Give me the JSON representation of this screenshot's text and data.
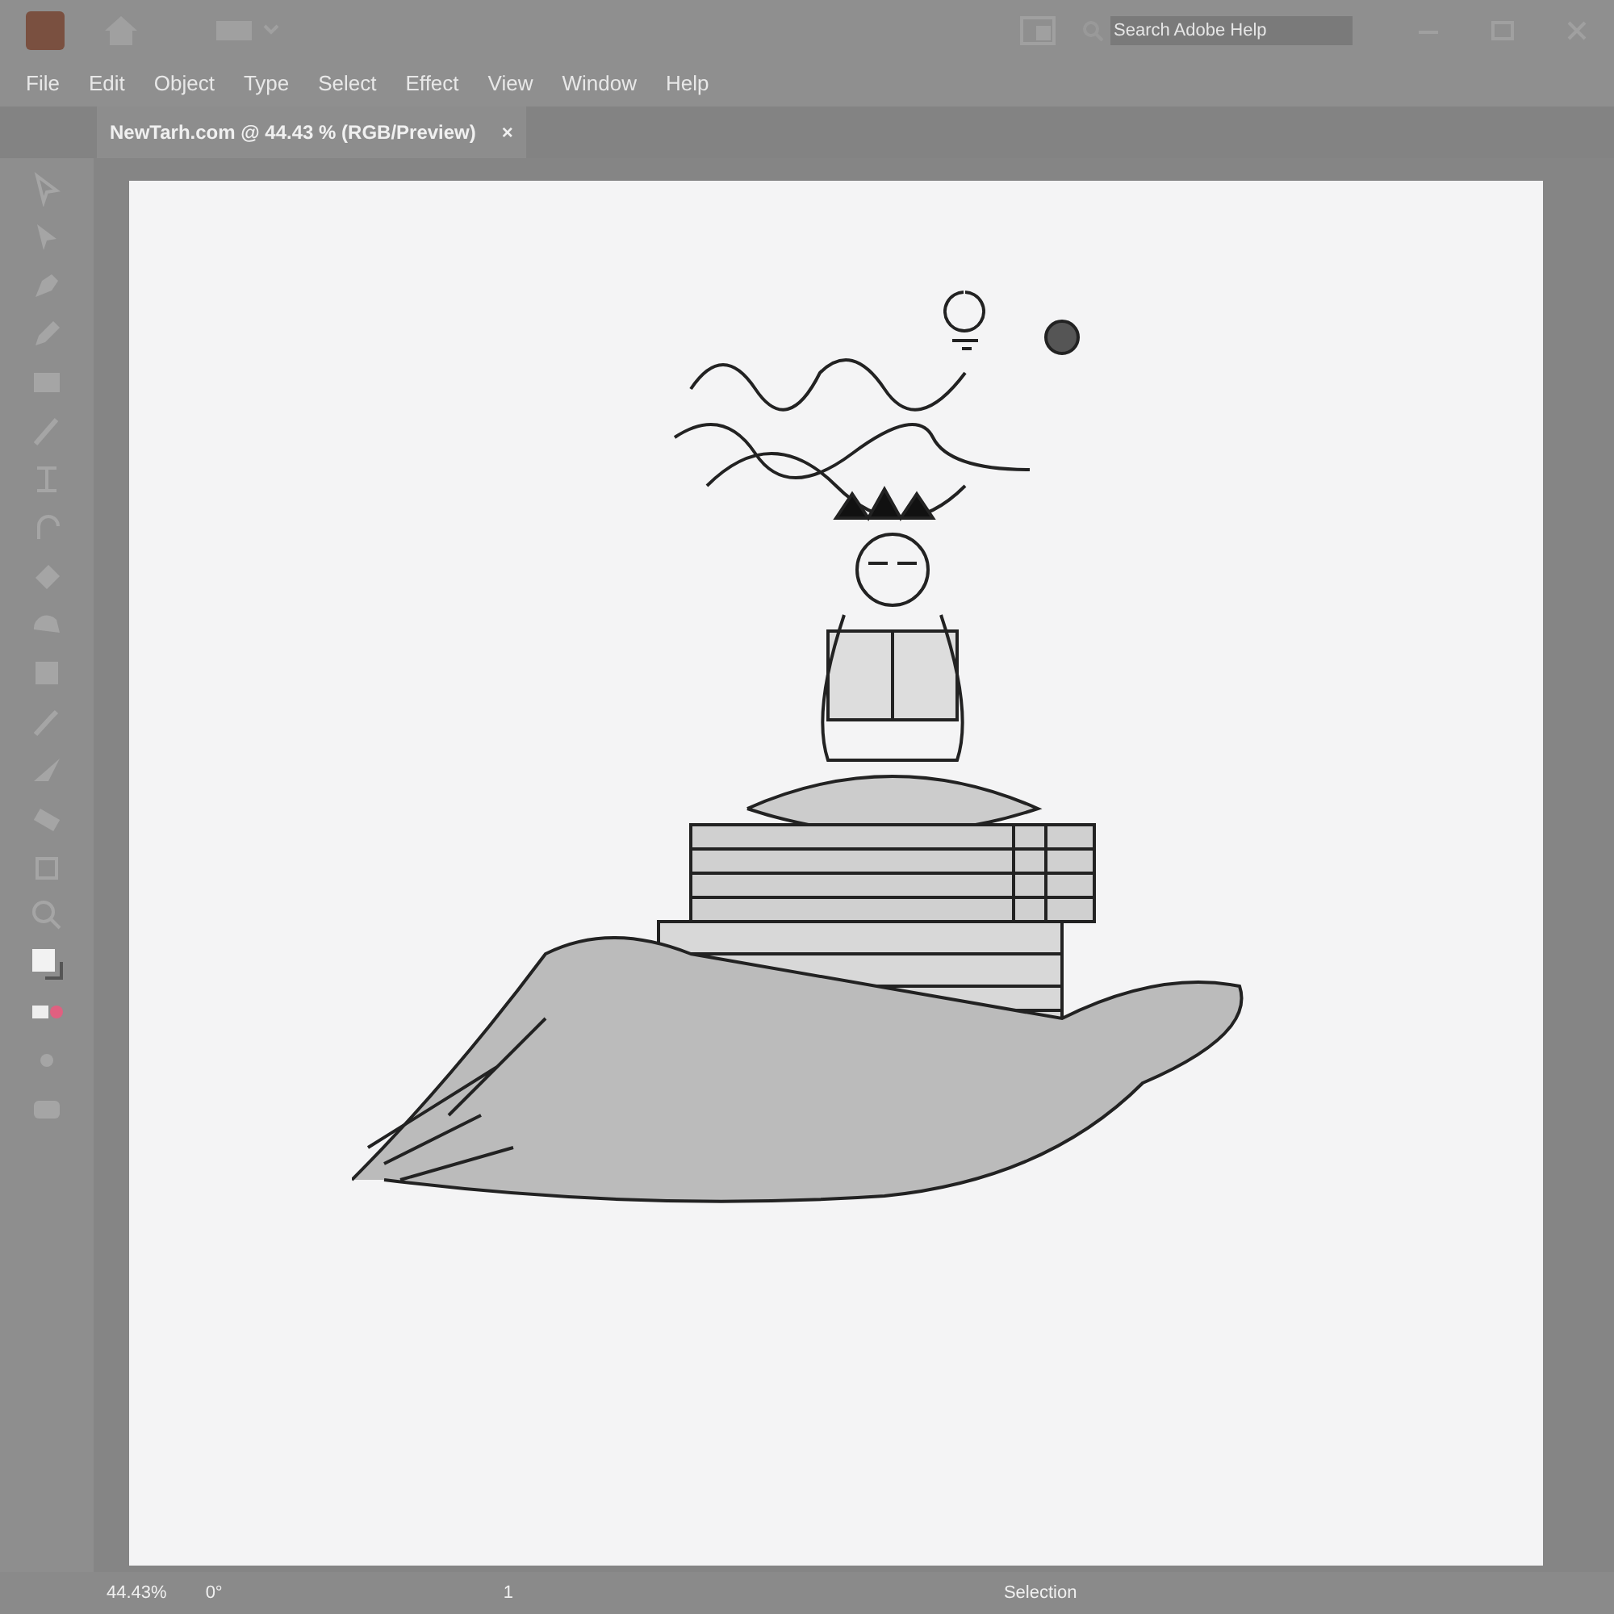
{
  "menu": [
    "File",
    "Edit",
    "Object",
    "Type",
    "Select",
    "Effect",
    "View",
    "Window",
    "Help"
  ],
  "search": {
    "placeholder": "Search Adobe Help"
  },
  "document_tab": {
    "title": "NewTarh.com @ 44.43 % (RGB/Preview)",
    "close": "×",
    "selected": true
  },
  "status_bar": {
    "zoom": "44.43%",
    "rotation": "0°",
    "artboard": "1",
    "tool": "Selection"
  }
}
